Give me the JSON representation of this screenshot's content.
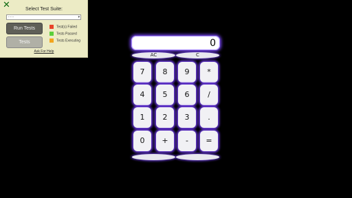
{
  "panel": {
    "close_glyph": "✕",
    "title": "Select Test Suite:",
    "select_value": "- - -",
    "run_tests_label": "Run Tests",
    "tests_label": "Tests",
    "legend": [
      {
        "label": "Test(s) Failed",
        "color": "#e8442a"
      },
      {
        "label": "Tests Passed",
        "color": "#5bcf3a"
      },
      {
        "label": "Tests Executing",
        "color": "#f3a51d"
      }
    ],
    "help_label": "Ask For Help"
  },
  "calculator": {
    "display_value": "0",
    "ac_label": "AC",
    "c_label": "C",
    "keys": [
      "7",
      "8",
      "9",
      "*",
      "4",
      "5",
      "6",
      "/",
      "1",
      "2",
      "3",
      ".",
      "0",
      "+",
      "-",
      "="
    ],
    "bottom_left_label": "",
    "bottom_right_label": ""
  }
}
